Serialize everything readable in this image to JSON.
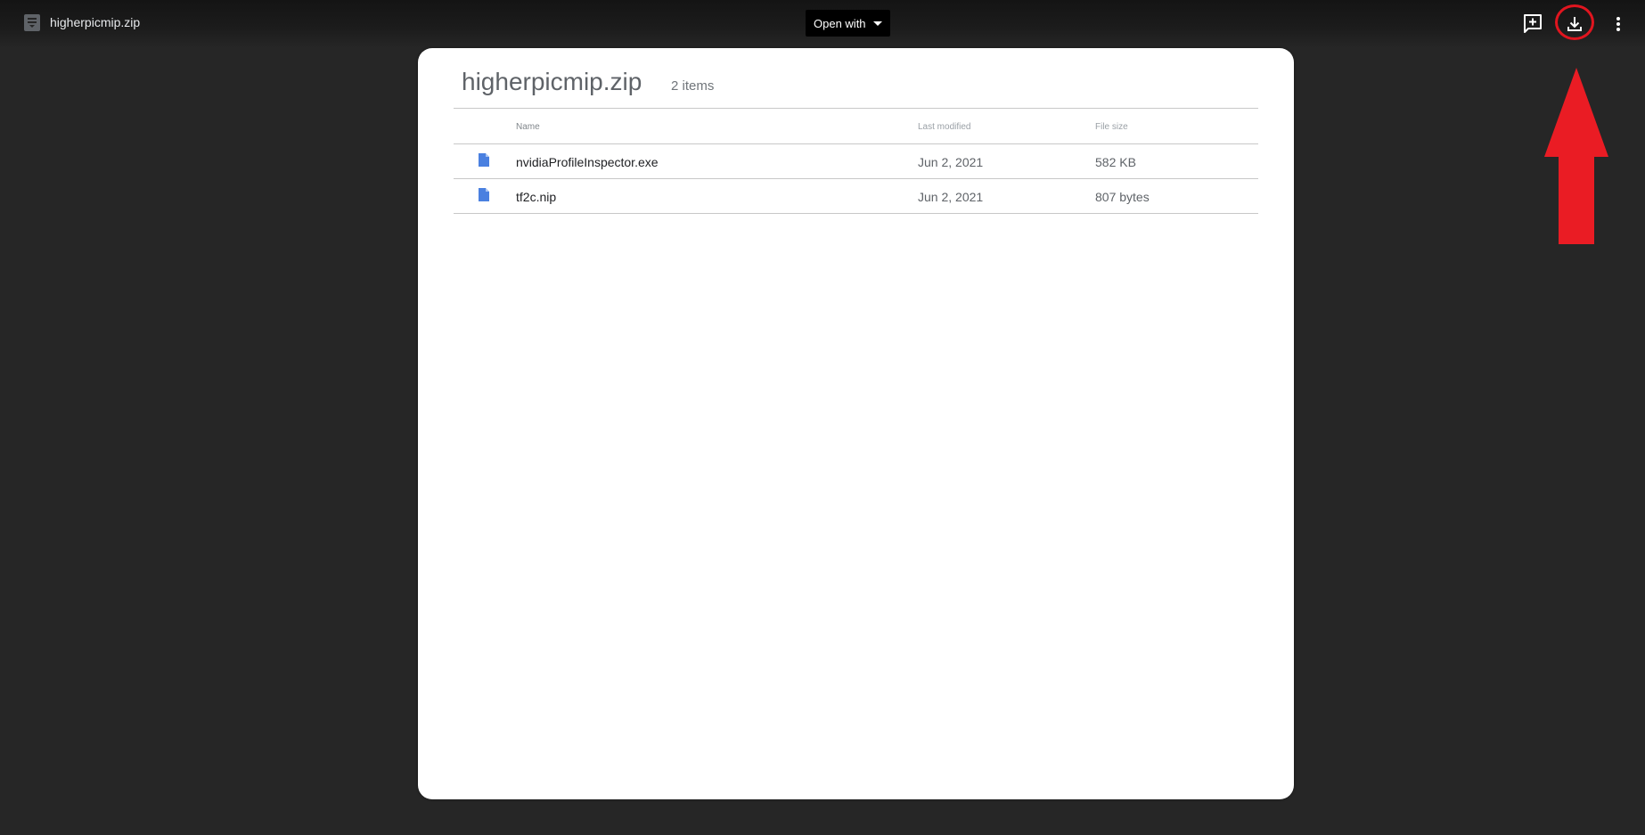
{
  "topbar": {
    "file_title": "higherpicmip.zip",
    "open_with_label": "Open with",
    "icons": [
      "file-icon",
      "add-comment-icon",
      "download-icon",
      "more-vert-icon"
    ],
    "highlight_color": "#e0151f"
  },
  "viewer": {
    "title": "higherpicmip.zip",
    "item_count": "2 items",
    "columns": {
      "name": "Name",
      "modified": "Last modified",
      "size": "File size"
    },
    "files": [
      {
        "name": "nvidiaProfileInspector.exe",
        "modified": "Jun 2, 2021",
        "size": "582 KB",
        "icon": "file-document-icon"
      },
      {
        "name": "tf2c.nip",
        "modified": "Jun 2, 2021",
        "size": "807 bytes",
        "icon": "file-document-icon"
      }
    ],
    "file_icon_color": "#4a80e0"
  }
}
